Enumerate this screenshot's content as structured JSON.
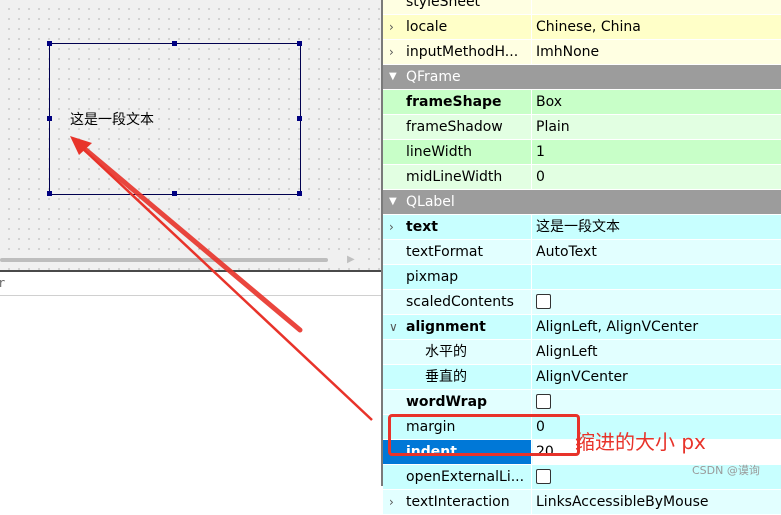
{
  "canvas": {
    "label_text": "这是一段文本"
  },
  "filter": {
    "placeholder": "r"
  },
  "properties": [
    {
      "kind": "row",
      "name": "styleSheet",
      "value": "",
      "style": "y2",
      "expander": false
    },
    {
      "kind": "row",
      "name": "locale",
      "value": "Chinese, China",
      "style": "y1",
      "expander": true
    },
    {
      "kind": "row",
      "name": "inputMethodH...",
      "value": "ImhNone",
      "style": "y2",
      "expander": true
    },
    {
      "kind": "header",
      "name": "QFrame"
    },
    {
      "kind": "row",
      "name": "frameShape",
      "value": "Box",
      "style": "g1",
      "bold": true
    },
    {
      "kind": "row",
      "name": "frameShadow",
      "value": "Plain",
      "style": "g2"
    },
    {
      "kind": "row",
      "name": "lineWidth",
      "value": "1",
      "style": "g1"
    },
    {
      "kind": "row",
      "name": "midLineWidth",
      "value": "0",
      "style": "g2"
    },
    {
      "kind": "header",
      "name": "QLabel"
    },
    {
      "kind": "row",
      "name": "text",
      "value": "这是一段文本",
      "style": "c1",
      "bold": true,
      "expander": true
    },
    {
      "kind": "row",
      "name": "textFormat",
      "value": "AutoText",
      "style": "c2"
    },
    {
      "kind": "row",
      "name": "pixmap",
      "value": "",
      "style": "c1"
    },
    {
      "kind": "row",
      "name": "scaledContents",
      "value": "",
      "style": "c2",
      "checkbox": true
    },
    {
      "kind": "row",
      "name": "alignment",
      "value": "AlignLeft, AlignVCenter",
      "style": "c1",
      "bold": true,
      "expanded": true
    },
    {
      "kind": "row",
      "name": "水平的",
      "value": "AlignLeft",
      "style": "c2",
      "sub": true
    },
    {
      "kind": "row",
      "name": "垂直的",
      "value": "AlignVCenter",
      "style": "c1",
      "sub": true
    },
    {
      "kind": "row",
      "name": "wordWrap",
      "value": "",
      "style": "c2",
      "bold": true,
      "checkbox": true
    },
    {
      "kind": "row",
      "name": "margin",
      "value": "0",
      "style": "c1"
    },
    {
      "kind": "row",
      "name": "indent",
      "value": "20",
      "style": "c2",
      "bold": true,
      "selected": true
    },
    {
      "kind": "row",
      "name": "openExternalLi...",
      "value": "",
      "style": "c1",
      "checkbox": true
    },
    {
      "kind": "row",
      "name": "textInteraction",
      "value": "LinksAccessibleByMouse",
      "style": "c2",
      "expander": true
    }
  ],
  "annotation": {
    "text": "缩进的大小 px",
    "color": "#e8332a"
  },
  "watermark": "CSDN @谟询"
}
